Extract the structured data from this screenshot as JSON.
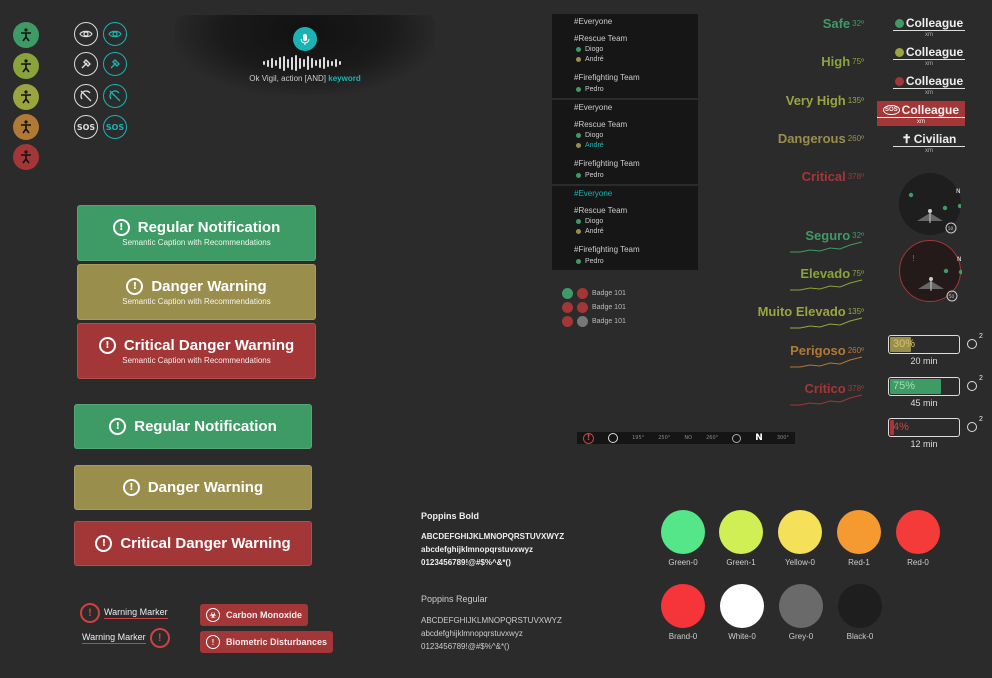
{
  "status_colors": [
    "#3f9b66",
    "#8aa33a",
    "#9aa540",
    "#b07a35",
    "#a33636"
  ],
  "icon_rows": [
    {
      "left": "eye-icon",
      "right": "eye-icon"
    },
    {
      "left": "flashlight-icon",
      "right": "flashlight-icon"
    },
    {
      "left": "no-sound-icon",
      "right": "no-sound-icon"
    },
    {
      "left": "sos-icon",
      "right": "sos-icon"
    }
  ],
  "sos_label": "SOS",
  "voice": {
    "prefix": "Ok Vigil, action [AND]",
    "keyword": "keyword"
  },
  "notifications_large": [
    {
      "title": "Regular Notification",
      "caption": "Semantic Caption with Recommendations"
    },
    {
      "title": "Danger Warning",
      "caption": "Semantic Caption with Recommendations"
    },
    {
      "title": "Critical Danger Warning",
      "caption": "Semantic Caption with Recommendations"
    }
  ],
  "notifications_small": [
    {
      "title": "Regular Notification"
    },
    {
      "title": "Danger Warning"
    },
    {
      "title": "Critical Danger Warning"
    }
  ],
  "markers": [
    "Warning Marker",
    "Warning Marker"
  ],
  "tags": [
    "Carbon Monoxide",
    "Biometric Disturbances"
  ],
  "chat_panels": [
    {
      "everyone": "#Everyone",
      "rescue": "#Rescue Team",
      "diogo": "Diogo",
      "andre": "André",
      "fire": "#Firefighting Team",
      "pedro": "Pedro"
    },
    {
      "everyone": "#Everyone",
      "rescue": "#Rescue Team",
      "diogo": "Diogo",
      "andre": "André",
      "fire": "#Firefighting Team",
      "pedro": "Pedro"
    },
    {
      "everyone": "#Everyone",
      "rescue": "#Rescue Team",
      "diogo": "Diogo",
      "andre": "André",
      "fire": "#Firefighting Team",
      "pedro": "Pedro"
    }
  ],
  "badges": [
    "Badge 101",
    "Badge 101",
    "Badge 101"
  ],
  "levels_en": [
    {
      "label": "Safe",
      "value": "32º",
      "color": "#3f9b66"
    },
    {
      "label": "High",
      "value": "75º",
      "color": "#8aa33a"
    },
    {
      "label": "Very High",
      "value": "135º",
      "color": "#9aa540"
    },
    {
      "label": "Dangerous",
      "value": "260º",
      "color": "#9a8e4d"
    },
    {
      "label": "Critical",
      "value": "378º",
      "color": "#a33636"
    }
  ],
  "levels_pt": [
    {
      "label": "Seguro",
      "value": "32º",
      "color": "#3f9b66"
    },
    {
      "label": "Elevado",
      "value": "75º",
      "color": "#8aa33a"
    },
    {
      "label": "Muito Elevado",
      "value": "135º",
      "color": "#9aa540"
    },
    {
      "label": "Perigoso",
      "value": "260º",
      "color": "#b07a35"
    },
    {
      "label": "Crítico",
      "value": "378º",
      "color": "#a33636"
    }
  ],
  "roles": [
    {
      "name": "Colleague",
      "sub": "xm",
      "dot": "#3f9b66"
    },
    {
      "name": "Colleague",
      "sub": "xm",
      "dot": "#9aa540"
    },
    {
      "name": "Colleague",
      "sub": "xm",
      "dot": "#a33636"
    },
    {
      "name": "Colleague",
      "sub": "xm",
      "sos": "SOS"
    },
    {
      "name": "Civilian",
      "sub": "xm"
    }
  ],
  "compass": {
    "north": "N",
    "scale": "50"
  },
  "oxygen": [
    {
      "percent": "30%",
      "fill": 0.3,
      "color": "#9a8e4d",
      "time": "20 min"
    },
    {
      "percent": "75%",
      "fill": 0.75,
      "color": "#3f9b66",
      "time": "45 min"
    },
    {
      "percent": "4%",
      "fill": 0.04,
      "color": "#a33636",
      "time": "12 min"
    }
  ],
  "oxygen_label": "O",
  "oxygen_sub": "2",
  "bottom_bar": [
    "195°",
    "250°",
    "NO",
    "260°",
    "N",
    "300°"
  ],
  "typography": {
    "bold_title": "Poppins Bold",
    "regular_title": "Poppins Regular",
    "upper": "ABCDEFGHIJKLMNOPQRSTUVXWYZ",
    "lower": "abcdefghijklmnopqrstuvxwyz",
    "nums": "0123456789!@#$%^&*()"
  },
  "palette": [
    {
      "name": "Green-0",
      "color": "#55e68a"
    },
    {
      "name": "Green-1",
      "color": "#cfef55"
    },
    {
      "name": "Yellow-0",
      "color": "#f5e05a"
    },
    {
      "name": "Red-1",
      "color": "#f59a30"
    },
    {
      "name": "Red-0",
      "color": "#f53a3a"
    },
    {
      "name": "Brand-0",
      "color": "#f5353a"
    },
    {
      "name": "White-0",
      "color": "#ffffff"
    },
    {
      "name": "Grey-0",
      "color": "#6a6a6a"
    },
    {
      "name": "Black-0",
      "color": "#1e1e1e"
    }
  ]
}
